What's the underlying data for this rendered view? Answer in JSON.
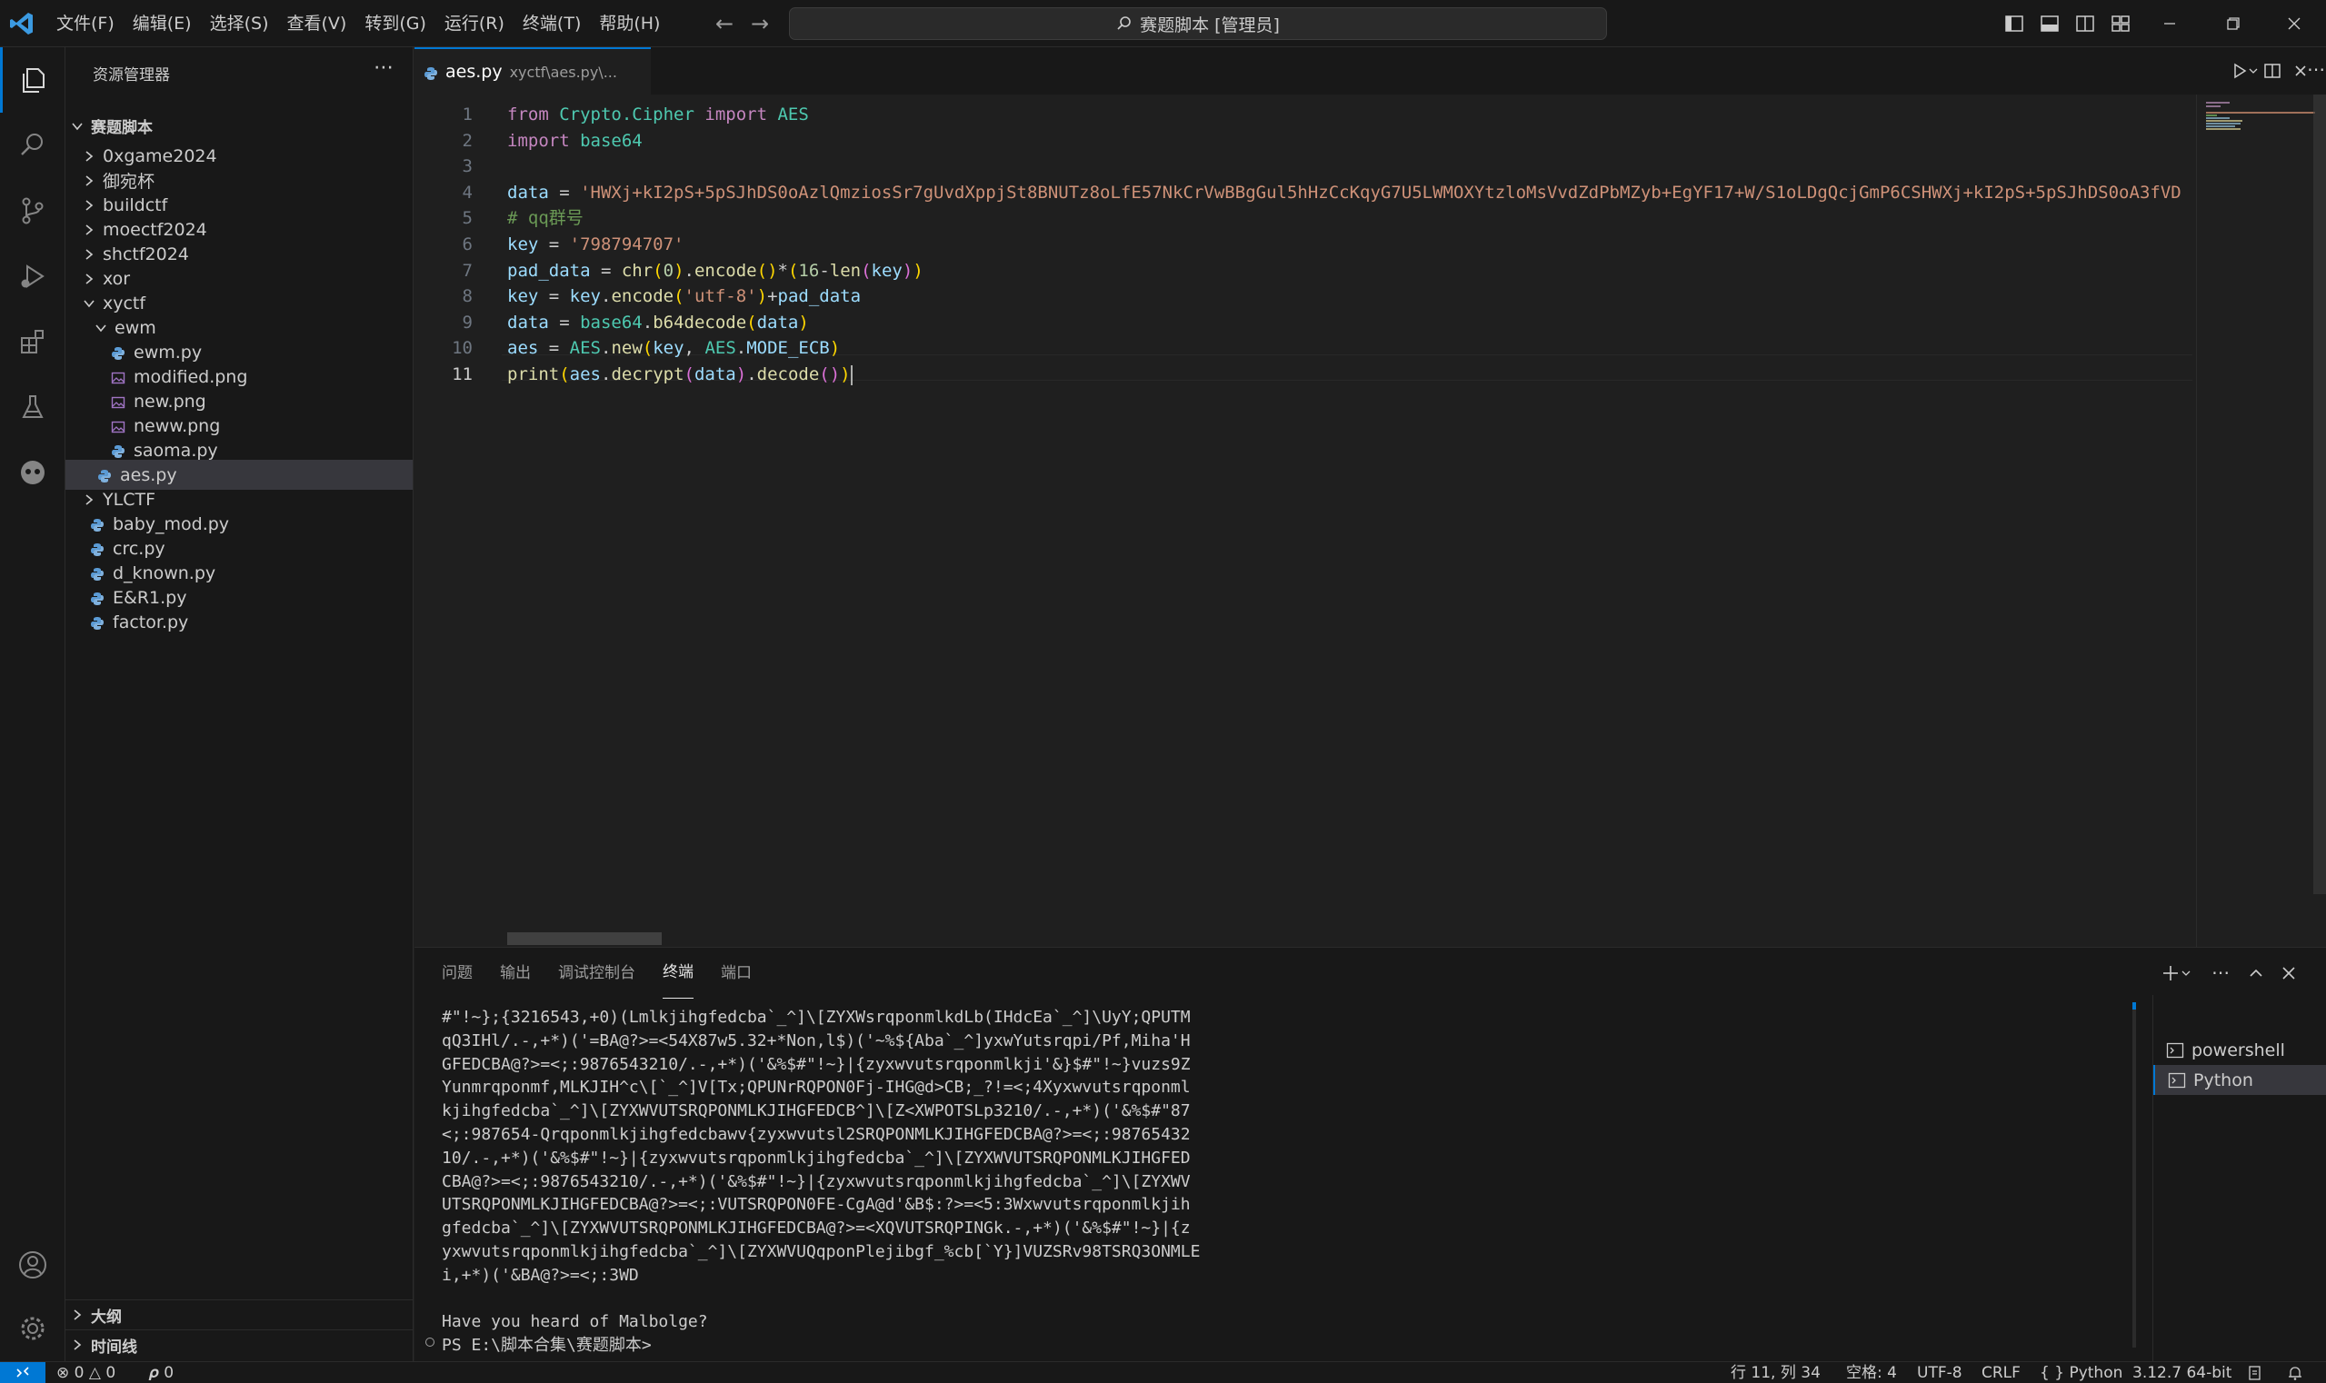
{
  "menu": [
    "文件(F)",
    "编辑(E)",
    "选择(S)",
    "查看(V)",
    "转到(G)",
    "运行(R)",
    "终端(T)",
    "帮助(H)"
  ],
  "command_center": "赛题脚本 [管理员]",
  "sidebar": {
    "title": "资源管理器",
    "root": "赛题脚本",
    "items": [
      {
        "label": "0xgame2024",
        "type": "folder"
      },
      {
        "label": "御宛杯",
        "type": "folder"
      },
      {
        "label": "buildctf",
        "type": "folder"
      },
      {
        "label": "moectf2024",
        "type": "folder"
      },
      {
        "label": "shctf2024",
        "type": "folder"
      },
      {
        "label": "xor",
        "type": "folder"
      },
      {
        "label": "xyctf",
        "type": "folder-open"
      },
      {
        "label": "ewm",
        "type": "folder-open"
      },
      {
        "label": "ewm.py",
        "type": "py"
      },
      {
        "label": "modified.png",
        "type": "png"
      },
      {
        "label": "new.png",
        "type": "png"
      },
      {
        "label": "neww.png",
        "type": "png"
      },
      {
        "label": "saoma.py",
        "type": "py"
      },
      {
        "label": "aes.py",
        "type": "py"
      },
      {
        "label": "YLCTF",
        "type": "folder"
      },
      {
        "label": "baby_mod.py",
        "type": "py"
      },
      {
        "label": "crc.py",
        "type": "py"
      },
      {
        "label": "d_known.py",
        "type": "py"
      },
      {
        "label": "E&R1.py",
        "type": "py"
      },
      {
        "label": "factor.py",
        "type": "py"
      }
    ],
    "outline": "大纲",
    "timeline": "时间线"
  },
  "editor": {
    "tab_name": "aes.py",
    "tab_path": "xyctf\\aes.py\\...",
    "line_numbers": [
      "1",
      "2",
      "3",
      "4",
      "5",
      "6",
      "7",
      "8",
      "9",
      "10",
      "11"
    ],
    "code": {
      "l1_kw": "from",
      "l1_mod": "Crypto.Cipher",
      "l1_kw2": "import",
      "l1_name": "AES",
      "l2_kw": "import",
      "l2_mod": "base64",
      "l4_var": "data",
      "l4_str": "'HWXj+kI2pS+5pSJhDS0oAzlQmziosSr7gUvdXppjSt8BNUTz8oLfE57NkCrVwBBgGul5hHzCcKqyG7U5LWMOXYtzloMsVvdZdPbMZyb+EgYF17+W/S1oLDgQcjGmP6CSHWXj+kI2pS+5pSJhDS0oA3fVD",
      "l5_cmt": "# qq群号",
      "l6_var": "key",
      "l6_str": "'798794707'",
      "l7_var": "pad_data",
      "l7_fn": "chr",
      "l7_num": "0",
      "l7_fn2": "encode",
      "l7_num2": "16",
      "l7_fn3": "len",
      "l7_var2": "key",
      "l8_var": "key",
      "l8_fn": "encode",
      "l8_str": "'utf-8'",
      "l8_var2": "pad_data",
      "l9_var": "data",
      "l9_mod": "base64",
      "l9_fn": "b64decode",
      "l9_var2": "data",
      "l10_var": "aes",
      "l10_mod": "AES",
      "l10_fn": "new",
      "l10_var2": "key",
      "l10_mod2": "AES",
      "l10_var3": "MODE_ECB",
      "l11_fn": "print",
      "l11_var": "aes",
      "l11_fn2": "decrypt",
      "l11_var2": "data",
      "l11_fn3": "decode"
    }
  },
  "panel": {
    "tabs": [
      "问题",
      "输出",
      "调试控制台",
      "终端",
      "端口"
    ],
    "active_tab": "终端",
    "terminal_lines": [
      "#\"!~};{3216543,+0)(Lmlkjihgfedcba`_^]\\[ZYXWsrqponmlkdLb(IHdcEa`_^]\\UyY;QPUTM",
      "qQ3IHl/.-,+*)('=BA@?>=<54X87w5.32+*Non,l$)('~%${Aba`_^]yxwYutsrqpi/Pf,Miha'H",
      "GFEDCBA@?>=<;:9876543210/.-,+*)('&%$#\"!~}|{zyxwvutsrqponmlkji'&}$#\"!~}vuzs9Z",
      "Yunmrqponmf,MLKJIH^c\\[`_^]V[Tx;QPUNrRQPON0Fj-IHG@d>CB;_?!=<;4Xyxwvutsrqponml",
      "kjihgfedcba`_^]\\[ZYXWVUTSRQPONMLKJIHGFEDCB^]\\[Z<XWPOTSLp3210/.-,+*)('&%$#\"87",
      "<;:987654-Qrqponmlkjihgfedcbawv{zyxwvutsl2SRQPONMLKJIHGFEDCBA@?>=<;:98765432",
      "10/.-,+*)('&%$#\"!~}|{zyxwvutsrqponmlkjihgfedcba`_^]\\[ZYXWVUTSRQPONMLKJIHGFED",
      "CBA@?>=<;:9876543210/.-,+*)('&%$#\"!~}|{zyxwvutsrqponmlkjihgfedcba`_^]\\[ZYXWV",
      "UTSRQPONMLKJIHGFEDCBA@?>=<;:VUTSRQPON0FE-CgA@d'&B$:?>=<5:3Wxwvutsrqponmlkjih",
      "gfedcba`_^]\\[ZYXWVUTSRQPONMLKJIHGFEDCBA@?>=<XQVUTSRQPINGk.-,+*)('&%$#\"!~}|{z",
      "yxwvutsrqponmlkjihgfedcba`_^]\\[ZYXWVUQqponPlejibgf_%cb[`Y}]VUZSRv98TSRQ3ONMLE",
      "i,+*)('&BA@?>=<;:3WD",
      "",
      "Have you heard of Malbolge?",
      "PS E:\\脚本合集\\赛题脚本>"
    ],
    "terminals": [
      "powershell",
      "Python"
    ]
  },
  "statusbar": {
    "errors": "0",
    "warnings": "0",
    "ports": "0",
    "position": "行 11, 列 34",
    "spaces": "空格: 4",
    "encoding": "UTF-8",
    "eol": "CRLF",
    "language": "Python",
    "interpreter": "3.12.7 64-bit"
  },
  "colors": {
    "accent": "#0078d4",
    "background": "#1f1f1f",
    "chrome": "#181818"
  }
}
